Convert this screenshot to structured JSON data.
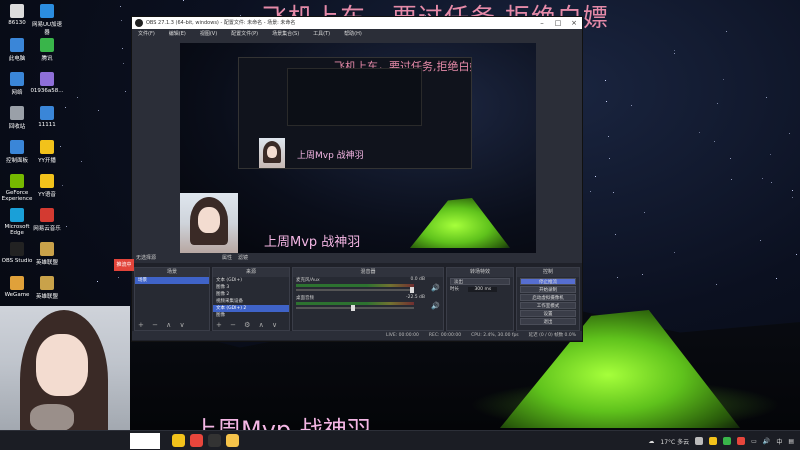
{
  "overlay": {
    "top_text": "飞机上车，要过任务,拒绝白嫖",
    "bottom_text": "上周Mvp  战神羽"
  },
  "desktop_icons": [
    {
      "label": "86130",
      "color": "#dcdcdc"
    },
    {
      "label": "网易UU加速器",
      "color": "#2b8de0"
    },
    {
      "label": "此电脑",
      "color": "#3a86d8"
    },
    {
      "label": "腾讯",
      "color": "#39b54a"
    },
    {
      "label": "网络",
      "color": "#3a86d8"
    },
    {
      "label": "01936a58...",
      "color": "#8e6fd8"
    },
    {
      "label": "回收站",
      "color": "#9aa0a8"
    },
    {
      "label": "11111",
      "color": "#3a86d8"
    },
    {
      "label": "控制面板",
      "color": "#3a86d8"
    },
    {
      "label": "YY开播",
      "color": "#f2c21b"
    },
    {
      "label": "GeForce Experience",
      "color": "#76b900"
    },
    {
      "label": "YY语音",
      "color": "#f2c21b"
    },
    {
      "label": "Microsoft Edge",
      "color": "#1aa0d8"
    },
    {
      "label": "网易云音乐",
      "color": "#d33a31"
    },
    {
      "label": "OBS Studio",
      "color": "#222222"
    },
    {
      "label": "英雄联盟",
      "color": "#c9a24a"
    },
    {
      "label": "WeGame",
      "color": "#e0a13a"
    },
    {
      "label": "英雄联盟",
      "color": "#c9a24a"
    }
  ],
  "obs": {
    "title": "OBS 27.1.3 (64-bit, windows) - 配置文件: 未命名 - 场景: 未命名",
    "menu": [
      "文件(F)",
      "编辑(E)",
      "视图(V)",
      "配置文件(P)",
      "场景集合(S)",
      "工具(T)",
      "帮助(H)"
    ],
    "scene_label": "无选择源",
    "scene_bar_buttons": [
      "属性",
      "滤镜"
    ],
    "docks": {
      "scenes": {
        "title": "场景",
        "items": [
          "场景"
        ]
      },
      "sources": {
        "title": "来源",
        "items": [
          "文本 (GDI+)",
          "图像 3",
          "图像 2",
          "视频采集设备",
          "文本 (GDI+) 2",
          "图像"
        ]
      },
      "mixer": {
        "title": "混音器",
        "channels": [
          {
            "name": "麦克风/Aux",
            "db": "0.0 dB"
          },
          {
            "name": "桌面音频",
            "db": "-22.5 dB"
          }
        ]
      },
      "transitions": {
        "title": "转场特效",
        "type": "淡出",
        "duration_label": "时长",
        "duration": "300 ms"
      },
      "controls": {
        "title": "控制",
        "buttons": [
          "停止推流",
          "开始录制",
          "启动虚拟摄像机",
          "工作室模式",
          "设置",
          "退出"
        ]
      }
    },
    "status": {
      "live": "LIVE: 00:00:00",
      "rec": "REC: 00:00:00",
      "cpu": "CPU: 2.4%, 30.00 fps",
      "dropped": "延迟 (0 / 0) 帧数 0.0%"
    }
  },
  "preview": {
    "nested_text": "飞机上车，要过任务,拒绝白嫖",
    "nested_mvp": "上周Mvp  战神羽",
    "preview_mvp": "上周Mvp  战神羽"
  },
  "webcam": {
    "red_tab_label": "推流中"
  },
  "taskbar": {
    "weather": "17°C  多云",
    "apps": [
      {
        "name": "yy-app-icon",
        "color": "#f2c21b"
      },
      {
        "name": "chrome-icon",
        "color": "#e7463c"
      },
      {
        "name": "obs-icon",
        "color": "#333333"
      },
      {
        "name": "file-explorer-icon",
        "color": "#f5c34a"
      }
    ]
  }
}
